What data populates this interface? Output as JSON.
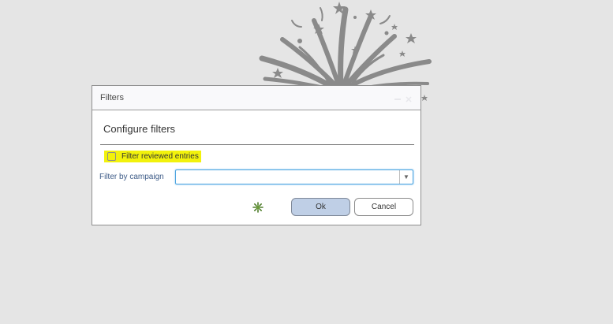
{
  "dialog": {
    "title": "Filters",
    "heading": "Configure filters",
    "filter_reviewed_label": "Filter reviewed entries",
    "filter_reviewed_checked": false,
    "campaign_label": "Filter by campaign",
    "campaign_value": "",
    "ok_label": "Ok",
    "cancel_label": "Cancel"
  },
  "colors": {
    "highlight": "#f2f20c",
    "ok_button": "#bfcfe6",
    "select_focus": "#4aa3df",
    "background": "#e5e5e5",
    "burst": "#8a8a8a"
  },
  "icons": {
    "background": "firework-burst-icon",
    "busy": "loading-spinner-icon",
    "dropdown": "chevron-down-icon",
    "window_controls": [
      "minimize-icon",
      "close-icon"
    ]
  }
}
